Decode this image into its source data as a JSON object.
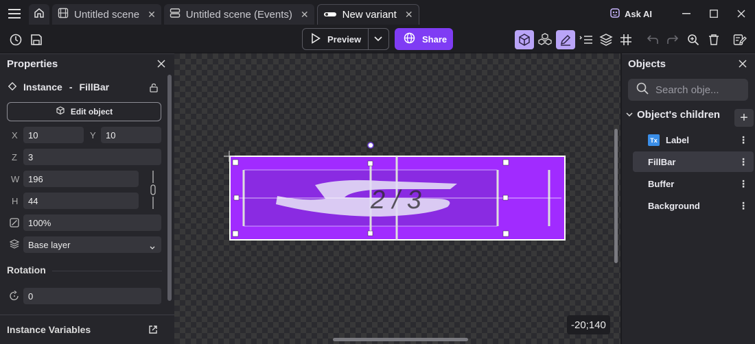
{
  "tabs": [
    {
      "label": "Untitled scene"
    },
    {
      "label": "Untitled scene (Events)"
    },
    {
      "label": "New variant"
    }
  ],
  "ask_ai": "Ask AI",
  "toolbar": {
    "preview_label": "Preview",
    "share_label": "Share"
  },
  "properties": {
    "title": "Properties",
    "instance_label": "Instance",
    "instance_sep": "-",
    "instance_name": "FillBar",
    "edit_object_label": "Edit object",
    "x_label": "X",
    "x_value": "10",
    "y_label": "Y",
    "y_value": "10",
    "z_label": "Z",
    "z_value": "3",
    "w_label": "W",
    "w_value": "196",
    "h_label": "H",
    "h_value": "44",
    "opacity_value": "100%",
    "layer_value": "Base layer",
    "rotation_label": "Rotation",
    "rotation_value": "0",
    "instance_variables_label": "Instance Variables"
  },
  "canvas": {
    "label_text": "2 / 3",
    "coordinates": "-20;140",
    "bar_color": "#a12bff",
    "fill_color": "#8a2be2"
  },
  "objects": {
    "title": "Objects",
    "search_placeholder": "Search obje...",
    "tree_title": "Object's children",
    "items": [
      {
        "label": "Label"
      },
      {
        "label": "FillBar"
      },
      {
        "label": "Buffer"
      },
      {
        "label": "Background"
      }
    ]
  },
  "colors": {
    "accent": "#7f3cf4",
    "selected_tool": "#b9a4f7"
  }
}
